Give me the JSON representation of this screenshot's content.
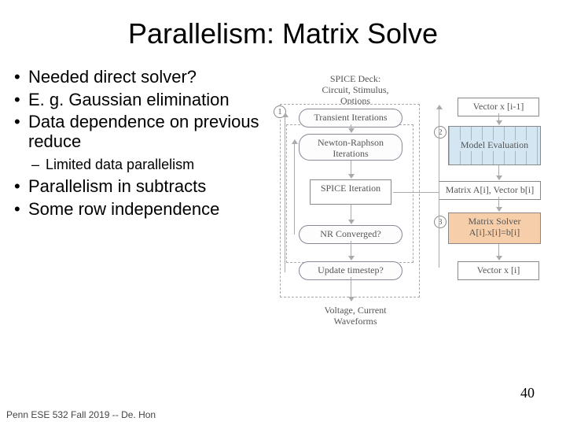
{
  "title": "Parallelism: Matrix Solve",
  "bullets": {
    "b0": "Needed direct solver?",
    "b1": "E. g. Gaussian elimination",
    "b2": "Data dependence on previous reduce",
    "b2s": "Limited data parallelism",
    "b3": "Parallelism in subtracts",
    "b4": "Some row independence"
  },
  "diagram": {
    "deck_label": "SPICE Deck:",
    "deck_body": "Circuit, Stimulus, Options",
    "transient": "Transient Iterations",
    "newton": "Newton-Raphson Iterations",
    "iteration": "SPICE Iteration",
    "nr_conv": "NR Converged?",
    "upd_ts": "Update timestep?",
    "output": "Voltage, Current Waveforms",
    "vec_prev": "Vector x [i-1]",
    "model_eval": "Model Evaluation",
    "mat_vec": "Matrix A[i], Vector b[i]",
    "solver_a": "Matrix Solver",
    "solver_b": "A[i].x[i]=b[i]",
    "vec_next": "Vector x [i]",
    "n1": "1",
    "n2": "2",
    "n3": "3"
  },
  "footer": "Penn ESE 532 Fall 2019 -- De. Hon",
  "pagenum": "40"
}
